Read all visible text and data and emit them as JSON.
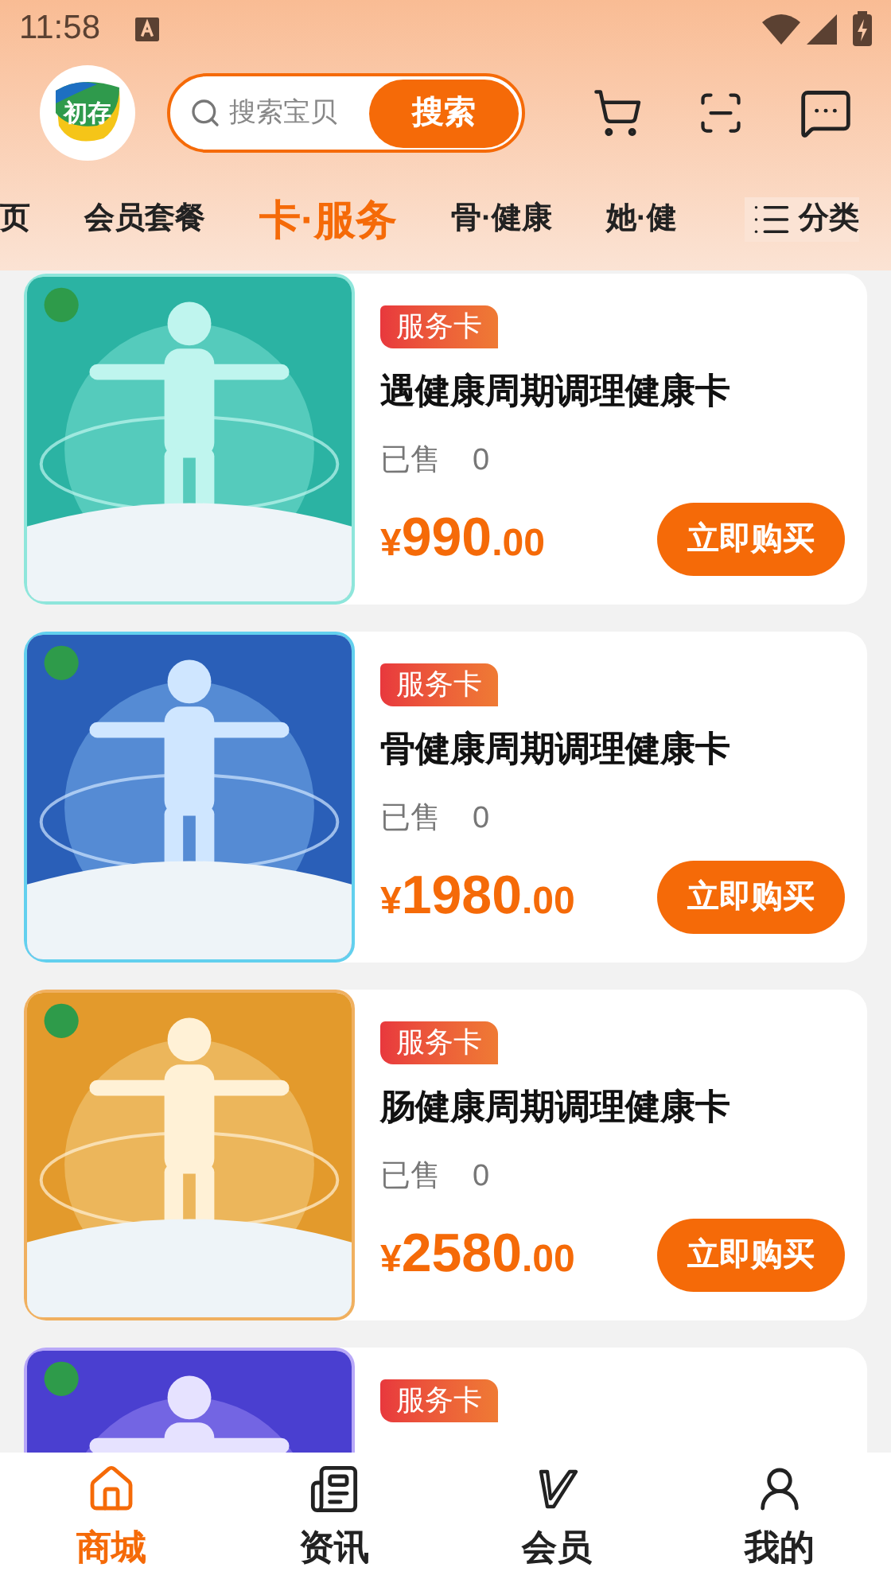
{
  "status_bar": {
    "time": "11:58"
  },
  "header": {
    "logo_text": "初存",
    "search": {
      "placeholder": "搜索宝贝",
      "button": "搜索"
    }
  },
  "tabs": [
    {
      "label": "页",
      "selected": false
    },
    {
      "label": "会员套餐",
      "selected": false
    },
    {
      "label": "卡·服务",
      "selected": true
    },
    {
      "label": "骨·健康",
      "selected": false
    },
    {
      "label": "她·健",
      "selected": false
    }
  ],
  "category_button": "分类",
  "products": [
    {
      "badge": "服务卡",
      "title": "遇健康周期调理健康卡",
      "sold_label": "已售",
      "sold": "0",
      "currency": "¥",
      "price": "990",
      "cents": ".00",
      "button": "立即购买"
    },
    {
      "badge": "服务卡",
      "title": "骨健康周期调理健康卡",
      "sold_label": "已售",
      "sold": "0",
      "currency": "¥",
      "price": "1980",
      "cents": ".00",
      "button": "立即购买"
    },
    {
      "badge": "服务卡",
      "title": "肠健康周期调理健康卡",
      "sold_label": "已售",
      "sold": "0",
      "currency": "¥",
      "price": "2580",
      "cents": ".00",
      "button": "立即购买"
    },
    {
      "badge": "服务卡"
    }
  ],
  "bottom_nav": [
    {
      "kind": "home",
      "label": "商城",
      "selected": true
    },
    {
      "kind": "news",
      "label": "资讯",
      "selected": false
    },
    {
      "kind": "vip",
      "label": "会员",
      "selected": false
    },
    {
      "kind": "me",
      "label": "我的",
      "selected": false
    }
  ]
}
